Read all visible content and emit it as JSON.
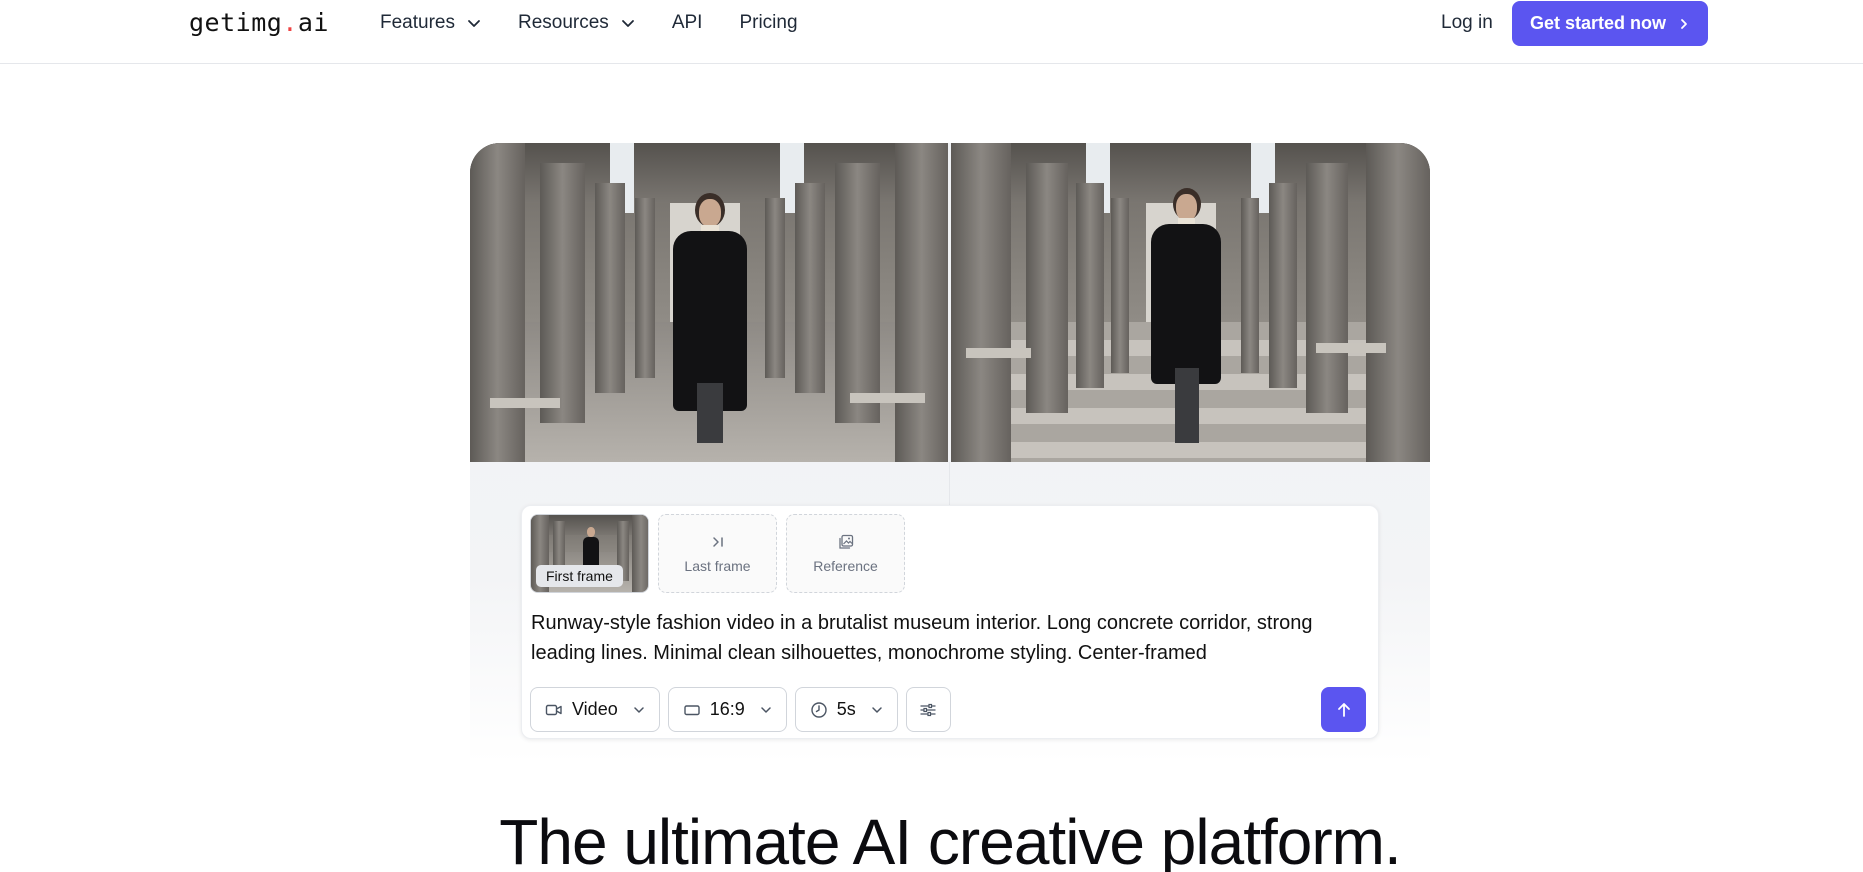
{
  "nav": {
    "logo_main": "getimg",
    "logo_dot": ".",
    "logo_tld": "ai",
    "links": [
      {
        "label": "Features",
        "has_dropdown": true
      },
      {
        "label": "Resources",
        "has_dropdown": true
      },
      {
        "label": "API",
        "has_dropdown": false
      },
      {
        "label": "Pricing",
        "has_dropdown": false
      }
    ],
    "login_label": "Log in",
    "cta_label": "Get started now"
  },
  "generator": {
    "frames": {
      "first_label": "First frame",
      "last_label": "Last frame",
      "reference_label": "Reference"
    },
    "prompt_text": "Runway-style fashion video in a brutalist museum interior. Long concrete corridor, strong leading lines. Minimal clean silhouettes, monochrome styling. Center-framed",
    "controls": {
      "mode": "Video",
      "aspect": "16:9",
      "duration": "5s"
    }
  },
  "headline": "The ultimate AI creative platform.",
  "colors": {
    "accent": "#5b55f0",
    "logo_dot": "#ef4444"
  }
}
